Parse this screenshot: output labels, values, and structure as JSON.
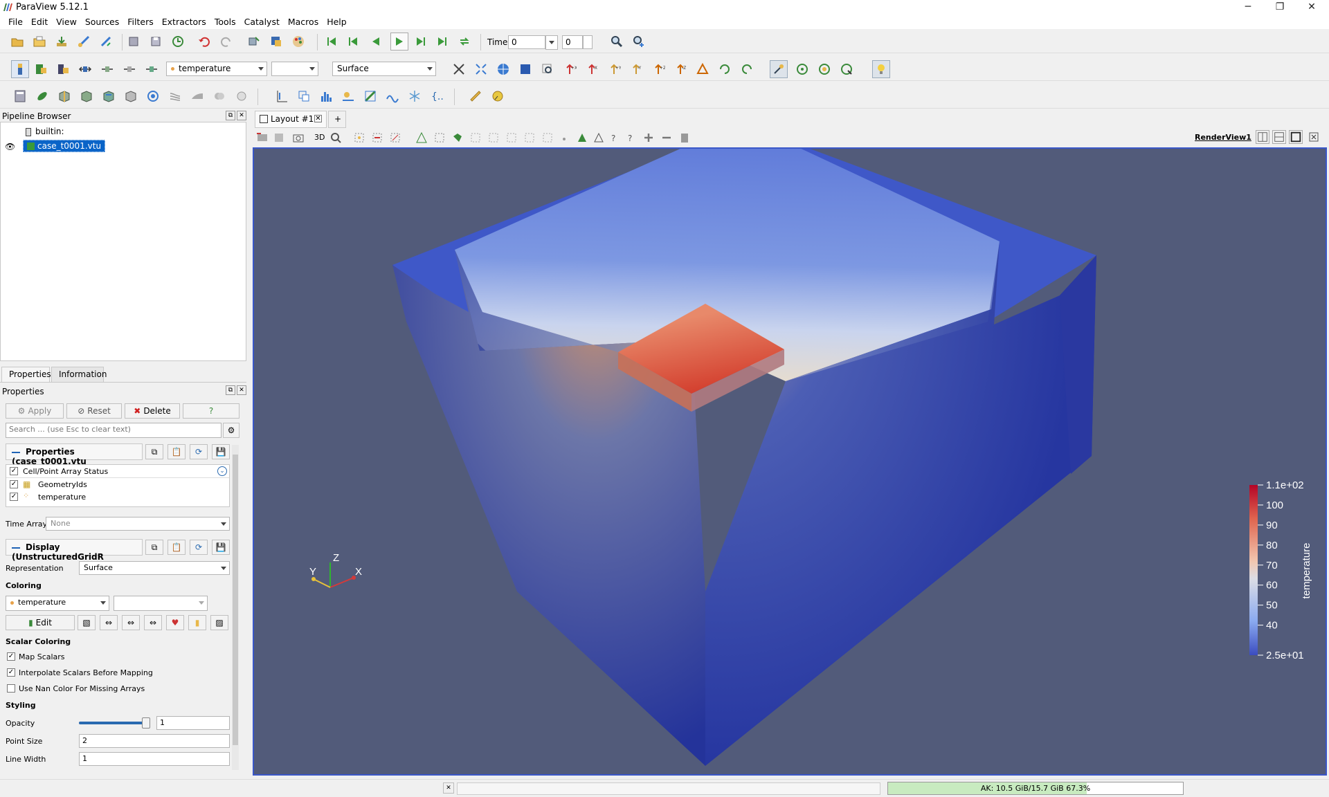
{
  "app": {
    "title": "ParaView 5.12.1"
  },
  "menu": [
    "File",
    "Edit",
    "View",
    "Sources",
    "Filters",
    "Extractors",
    "Tools",
    "Catalyst",
    "Macros",
    "Help"
  ],
  "toolbar": {
    "time_label": "Time:",
    "time_value": "0",
    "time_index": "0",
    "color_array": "temperature",
    "component": "",
    "representation": "Surface"
  },
  "pipeline": {
    "title": "Pipeline Browser",
    "root": "builtin:",
    "item": "case_t0001.vtu"
  },
  "tabs": {
    "properties": "Properties",
    "information": "Information"
  },
  "properties": {
    "title": "Properties",
    "apply": "Apply",
    "reset": "Reset",
    "delete": "Delete",
    "help": "?",
    "search_placeholder": "Search ... (use Esc to clear text)",
    "section_props": "Properties (case_t0001.vtu",
    "array_status_header": "Cell/Point Array Status",
    "arrays": [
      "GeometryIds",
      "temperature"
    ],
    "time_array_label": "Time Array",
    "time_array_value": "None",
    "section_display": "Display (UnstructuredGridR",
    "representation_label": "Representation",
    "representation_value": "Surface",
    "coloring_label": "Coloring",
    "coloring_array": "temperature",
    "edit_label": "Edit",
    "scalar_coloring_label": "Scalar Coloring",
    "map_scalars": "Map Scalars",
    "interpolate": "Interpolate Scalars Before Mapping",
    "nan_color": "Use Nan Color For Missing Arrays",
    "styling_label": "Styling",
    "opacity_label": "Opacity",
    "opacity_value": "1",
    "opacity_level": 1.0,
    "point_size_label": "Point Size",
    "point_size_value": "2",
    "line_width_label": "Line Width",
    "line_width_value": "1"
  },
  "layout": {
    "tab": "Layout #1",
    "add": "+",
    "view_name": "RenderView1",
    "mode": "3D"
  },
  "colorbar": {
    "title": "temperature",
    "labels": [
      "1.1e+02",
      "100",
      "90",
      "80",
      "70",
      "60",
      "50",
      "40",
      "2.5e+01"
    ]
  },
  "axes": {
    "x": "X",
    "y": "Y",
    "z": "Z"
  },
  "status": {
    "memory": "AK: 10.5 GiB/15.7 GiB 67.3%",
    "memory_fraction": 0.673
  },
  "colors": {
    "accent": "#0a64c8",
    "view_bg": "#525b7a",
    "view_border": "#3a57c8"
  }
}
